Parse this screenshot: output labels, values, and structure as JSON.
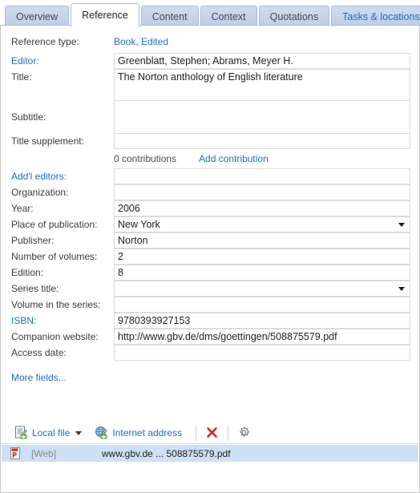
{
  "tabs": [
    {
      "label": "Overview",
      "active": false,
      "style": "normal"
    },
    {
      "label": "Reference",
      "active": true,
      "style": "normal"
    },
    {
      "label": "Content",
      "active": false,
      "style": "normal"
    },
    {
      "label": "Context",
      "active": false,
      "style": "normal"
    },
    {
      "label": "Quotations",
      "active": false,
      "style": "normal"
    },
    {
      "label": "Tasks & locations",
      "active": false,
      "style": "blue"
    }
  ],
  "form": {
    "reference_type": {
      "label": "Reference type:",
      "value": "Book, Edited"
    },
    "editor": {
      "label": "Editor:",
      "value": "Greenblatt, Stephen; Abrams, Meyer H."
    },
    "title": {
      "label": "Title:",
      "value": "The Norton anthology of English literature"
    },
    "subtitle": {
      "label": "Subtitle:",
      "value": ""
    },
    "title_supplement": {
      "label": "Title supplement:",
      "value": ""
    },
    "contributions": {
      "count_label": "0 contributions",
      "add_label": "Add contribution"
    },
    "addl_editors": {
      "label": "Add'l editors:",
      "value": ""
    },
    "organization": {
      "label": "Organization:",
      "value": ""
    },
    "year": {
      "label": "Year:",
      "value": "2006"
    },
    "place": {
      "label": "Place of publication:",
      "value": "New York"
    },
    "publisher": {
      "label": "Publisher:",
      "value": "Norton"
    },
    "num_volumes": {
      "label": "Number of volumes:",
      "value": "2"
    },
    "edition": {
      "label": "Edition:",
      "value": "8"
    },
    "series_title": {
      "label": "Series title:",
      "value": ""
    },
    "volume_series": {
      "label": "Volume in the series:",
      "value": ""
    },
    "isbn": {
      "label": "ISBN:",
      "value": "9780393927153"
    },
    "companion": {
      "label": "Companion website:",
      "value": "http://www.gbv.de/dms/goettingen/508875579.pdf"
    },
    "access_date": {
      "label": "Access date:",
      "value": ""
    },
    "more_fields": "More fields..."
  },
  "attachments": {
    "toolbar": {
      "local_file": "Local file",
      "internet_address": "Internet address",
      "delete_title": "Delete",
      "settings_title": "Settings"
    },
    "rows": [
      {
        "location": "[Web]",
        "filename": "www.gbv.de ... 508875579.pdf"
      }
    ]
  },
  "colors": {
    "link": "#1a6fc4",
    "tab_inactive": "#c3d3ea",
    "selection": "#cde0f5",
    "delete_red": "#d6211e",
    "plus_green": "#4ba428"
  }
}
